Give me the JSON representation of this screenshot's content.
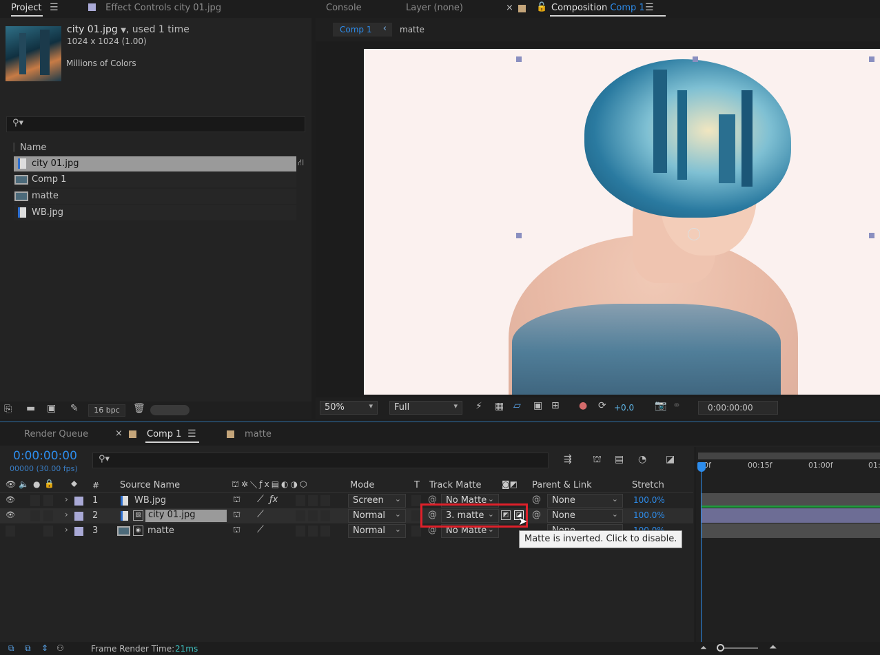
{
  "project": {
    "tab_project": "Project",
    "tab_effect_label": "Effect Controls",
    "tab_effect_file": "city 01.jpg",
    "thumb_title": "city 01.jpg",
    "thumb_used": ", used 1 time",
    "thumb_dims": "1024 x 1024 (1.00)",
    "thumb_colors": "Millions of Colors",
    "search_icon": "⚲▾",
    "col_name": "Name",
    "items": [
      {
        "label": "city 01.jpg",
        "type": "image",
        "selected": true
      },
      {
        "label": "Comp 1",
        "type": "comp",
        "selected": false
      },
      {
        "label": "matte",
        "type": "comp",
        "selected": false
      },
      {
        "label": "WB.jpg",
        "type": "image",
        "selected": false
      }
    ],
    "bpc": "16 bpc"
  },
  "viewer": {
    "tab_console": "Console",
    "tab_layer": "Layer (none)",
    "tab_comp_label": "Composition",
    "tab_comp_name": "Comp 1",
    "crumb_comp": "Comp 1",
    "crumb_matte": "matte",
    "zoom": "50%",
    "resolution": "Full",
    "exposure": "+0.0",
    "timecode": "0:00:00:00"
  },
  "timeline": {
    "tab_render": "Render Queue",
    "tab_comp": "Comp 1",
    "tab_matte": "matte",
    "current_time": "0:00:00:00",
    "fps": "00000 (30.00 fps)",
    "headers": {
      "num": "#",
      "source": "Source Name",
      "mode": "Mode",
      "t": "T",
      "track_matte": "Track Matte",
      "parent": "Parent & Link",
      "stretch": "Stretch"
    },
    "layers": [
      {
        "num": "1",
        "name": "WB.jpg",
        "mode": "Screen",
        "matte": "No Matte",
        "parent": "None",
        "stretch": "100.0%"
      },
      {
        "num": "2",
        "name": "city 01.jpg",
        "mode": "Normal",
        "matte": "3. matte",
        "parent": "None",
        "stretch": "100.0%"
      },
      {
        "num": "3",
        "name": "matte",
        "mode": "Normal",
        "matte": "No Matte",
        "parent": "None",
        "stretch": "100.0%"
      }
    ],
    "ruler": [
      "0f",
      "00:15f",
      "01:00f",
      "01:"
    ],
    "tooltip": "Matte is inverted. Click to disable.",
    "frame_render_label": "Frame Render Time:",
    "frame_render_value": "21ms"
  },
  "colors": {
    "accent_blue": "#2d8ceb",
    "highlight_red": "#e0202a",
    "layer_label_lavender": "#a9a9d6",
    "swatch_tan": "#c4a57a"
  }
}
